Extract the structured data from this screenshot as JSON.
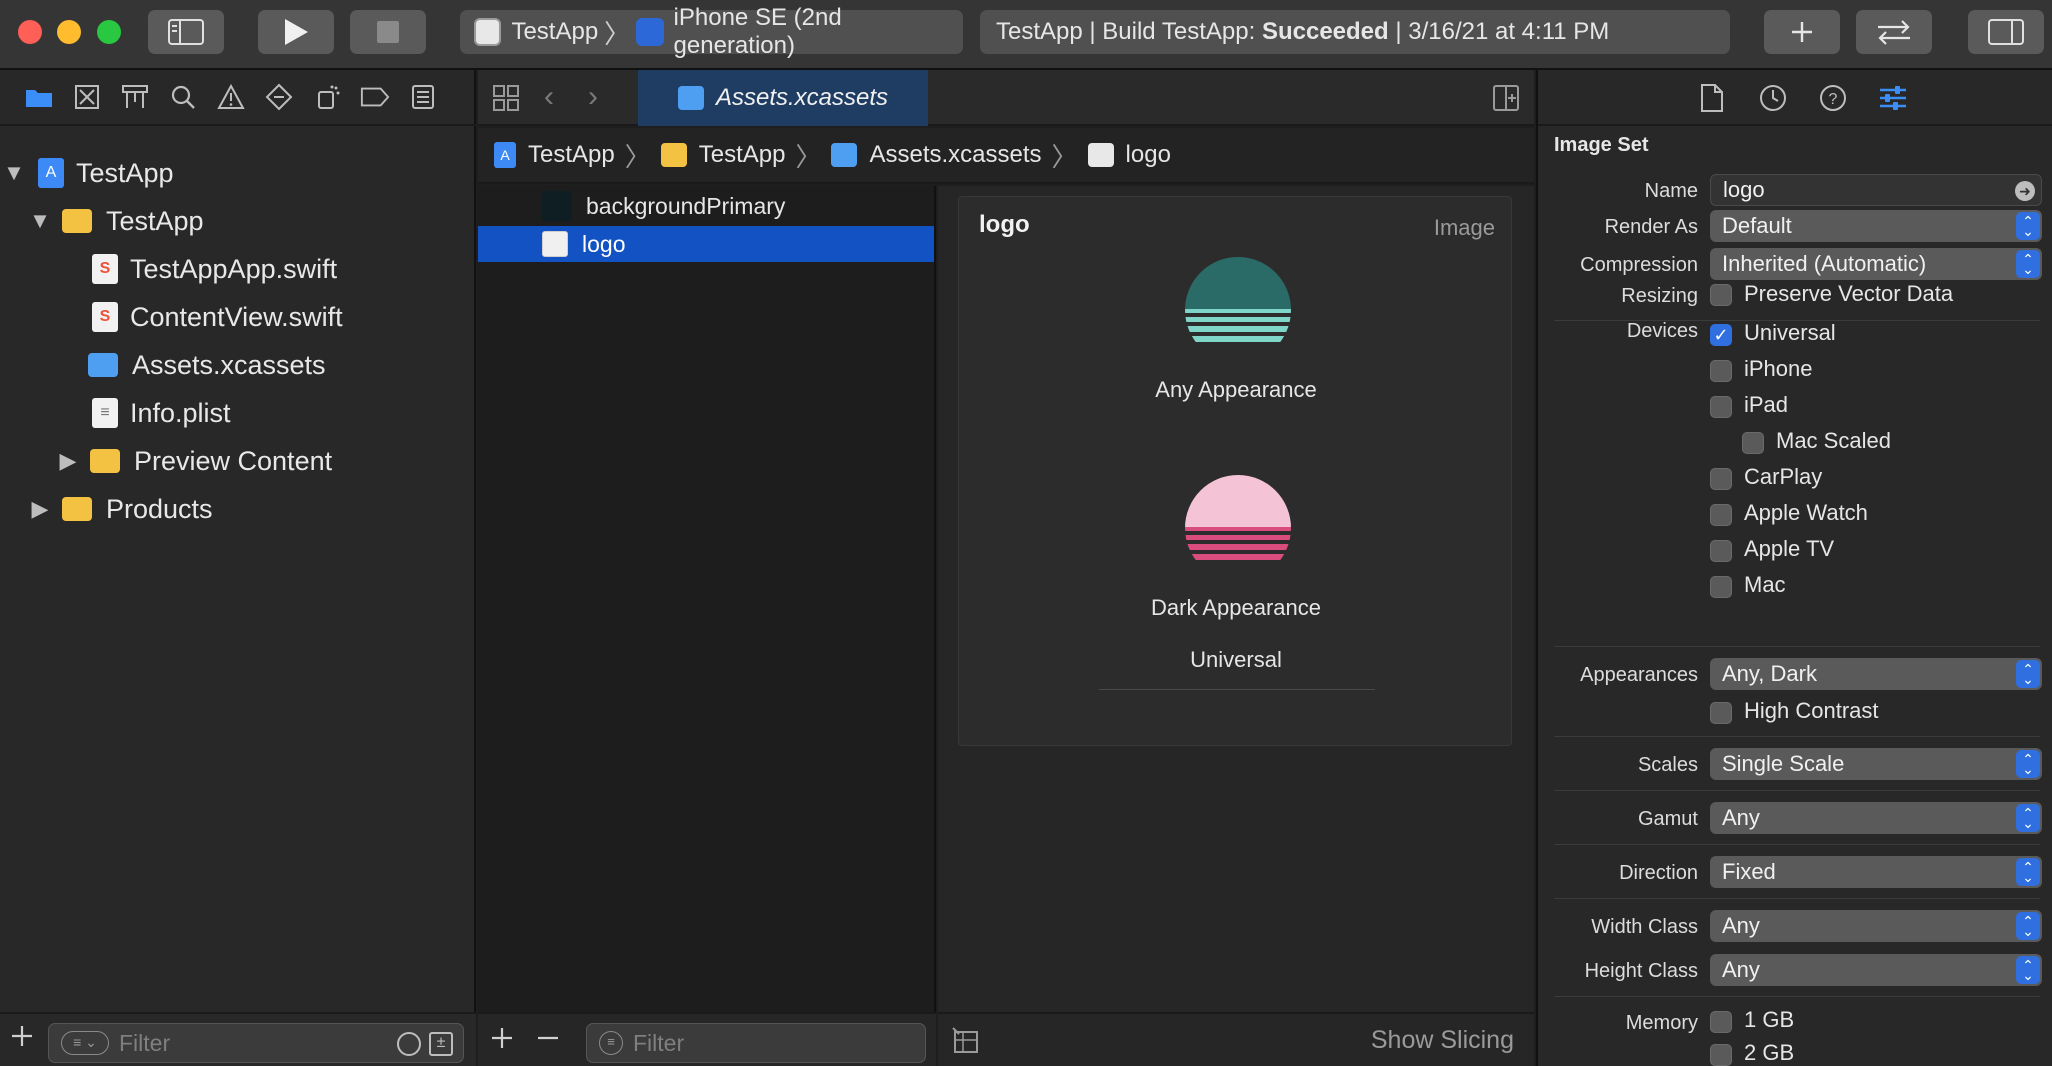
{
  "toolbar": {
    "scheme_name": "TestApp",
    "destination": "iPhone SE (2nd generation)",
    "status_prefix": "TestApp | Build TestApp: ",
    "status_result": "Succeeded",
    "status_suffix": " | 3/16/21 at 4:11 PM"
  },
  "navigator": {
    "items": [
      {
        "label": "TestApp"
      },
      {
        "label": "TestApp"
      },
      {
        "label": "TestAppApp.swift"
      },
      {
        "label": "ContentView.swift"
      },
      {
        "label": "Assets.xcassets"
      },
      {
        "label": "Info.plist"
      },
      {
        "label": "Preview Content"
      },
      {
        "label": "Products"
      }
    ],
    "filter_placeholder": "Filter"
  },
  "editor": {
    "tab_label": "Assets.xcassets",
    "breadcrumb": [
      "TestApp",
      "TestApp",
      "Assets.xcassets",
      "logo"
    ]
  },
  "asset_list": {
    "items": [
      {
        "label": "backgroundPrimary"
      },
      {
        "label": "logo"
      }
    ],
    "filter_placeholder": "Filter"
  },
  "asset_editor": {
    "title": "logo",
    "type_label": "Image",
    "slot_any": "Any Appearance",
    "slot_dark": "Dark Appearance",
    "device_label": "Universal",
    "show_slicing": "Show Slicing",
    "colors": {
      "logo_light_top": "#2a6b68",
      "logo_light_stripe": "#7fd5c8",
      "logo_dark_top": "#f4c3d5",
      "logo_dark_stripe": "#d94d7e"
    }
  },
  "inspector": {
    "heading": "Image Set",
    "name_label": "Name",
    "name_value": "logo",
    "render_as_label": "Render As",
    "render_as_value": "Default",
    "compression_label": "Compression",
    "compression_value": "Inherited (Automatic)",
    "resizing_label": "Resizing",
    "preserve_vector": "Preserve Vector Data",
    "devices_label": "Devices",
    "devices": [
      "Universal",
      "iPhone",
      "iPad",
      "Mac Scaled",
      "CarPlay",
      "Apple Watch",
      "Apple TV",
      "Mac"
    ],
    "appearances_label": "Appearances",
    "appearances_value": "Any, Dark",
    "high_contrast": "High Contrast",
    "scales_label": "Scales",
    "scales_value": "Single Scale",
    "gamut_label": "Gamut",
    "gamut_value": "Any",
    "direction_label": "Direction",
    "direction_value": "Fixed",
    "width_class_label": "Width Class",
    "width_class_value": "Any",
    "height_class_label": "Height Class",
    "height_class_value": "Any",
    "memory_label": "Memory",
    "memory": [
      "1 GB",
      "2 GB"
    ]
  }
}
